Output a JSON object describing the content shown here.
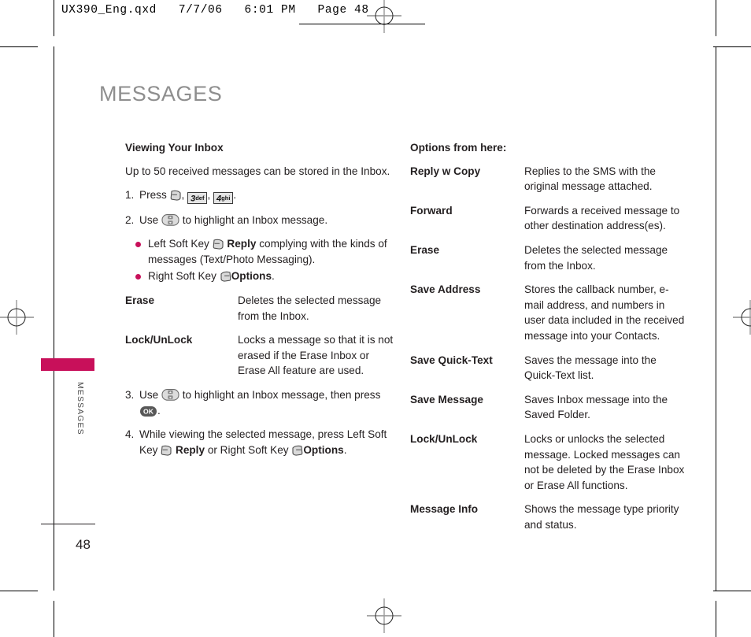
{
  "printer_slug": "UX390_Eng.qxd   7/7/06   6:01 PM   Page 48",
  "page": {
    "title": "MESSAGES",
    "side_tab_label": "MESSAGES",
    "folio": "48",
    "accent_color": "#c8105a",
    "title_color": "#8e8e8e"
  },
  "left_column": {
    "heading": "Viewing Your Inbox",
    "intro": "Up to 50 received messages can be stored in the Inbox.",
    "steps": [
      {
        "num": "1.",
        "text_before": "Press",
        "keys": [
          "left-soft-key",
          "key-3-def",
          "key-4-ghi"
        ],
        "key_labels": {
          "key3_digit": "3",
          "key3_letters": "def",
          "key4_digit": "4",
          "key4_letters": "ghi"
        },
        "text_after": "."
      },
      {
        "num": "2.",
        "text_before": "Use",
        "keys": [
          "navigation-key"
        ],
        "text_after": "to highlight an Inbox message."
      },
      {
        "num": "3.",
        "text_before": "Use",
        "keys": [
          "navigation-key"
        ],
        "text_mid": "to highlight an Inbox message, then press",
        "keys2": [
          "ok-key"
        ],
        "ok_label": "OK",
        "text_after": "."
      },
      {
        "num": "4.",
        "text_before": "While viewing the selected message, press Left Soft Key",
        "bold1": "Reply",
        "text_mid": "or Right Soft Key",
        "bold2": "Options",
        "text_after": "."
      }
    ],
    "bullets": [
      {
        "lead": "Left Soft Key",
        "icon": "left-soft-key",
        "bold": "Reply",
        "rest": "complying with the kinds of messages (Text/Photo Messaging)."
      },
      {
        "lead": "Right Soft Key",
        "icon": "right-soft-key",
        "bold": "Options",
        "rest": "."
      }
    ],
    "definitions": [
      {
        "term": "Erase",
        "desc": "Deletes the selected message from the Inbox."
      },
      {
        "term": "Lock/UnLock",
        "desc": "Locks a message so that it is not erased if the Erase Inbox or Erase All feature are used."
      }
    ]
  },
  "right_column": {
    "heading": "Options from here:",
    "definitions": [
      {
        "term": "Reply w Copy",
        "desc": "Replies to the SMS with the original message attached."
      },
      {
        "term": "Forward",
        "desc": "Forwards a received message to other destination address(es)."
      },
      {
        "term": "Erase",
        "desc": "Deletes the selected message from the Inbox."
      },
      {
        "term": "Save Address",
        "desc": "Stores the callback number, e-mail address, and numbers in user data included in the received message into your Contacts."
      },
      {
        "term": "Save Quick-Text",
        "desc": "Saves the message into the Quick-Text list."
      },
      {
        "term": "Save Message",
        "desc": "Saves Inbox message into the Saved Folder."
      },
      {
        "term": "Lock/UnLock",
        "desc": "Locks or unlocks the selected message. Locked messages can not be deleted by the Erase Inbox or Erase All functions."
      },
      {
        "term": "Message Info",
        "desc": "Shows the message type priority and status."
      }
    ]
  }
}
